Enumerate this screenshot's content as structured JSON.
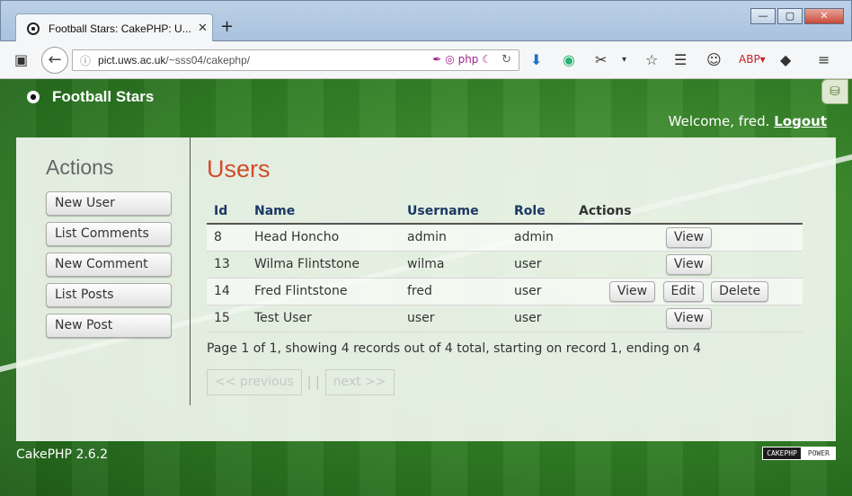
{
  "browser": {
    "tab_title": "Football Stars: CakePHP: U...",
    "tab_close": "✕",
    "new_tab": "+",
    "url_host": "pict.uws.ac.uk",
    "url_path": "/~sss04/cakephp/",
    "win_min": "—",
    "win_max": "▢",
    "win_close": "✕"
  },
  "header": {
    "title": "Football Stars",
    "welcome": "Welcome, fred.",
    "logout": "Logout"
  },
  "sidebar": {
    "heading": "Actions",
    "items": [
      {
        "label": "New User"
      },
      {
        "label": "List Comments"
      },
      {
        "label": "New Comment"
      },
      {
        "label": "List Posts"
      },
      {
        "label": "New Post"
      }
    ]
  },
  "main": {
    "heading": "Users",
    "columns": [
      "Id",
      "Name",
      "Username",
      "Role",
      "Actions"
    ],
    "rows": [
      {
        "id": "8",
        "name": "Head Honcho",
        "username": "admin",
        "role": "admin",
        "actions": [
          "View"
        ]
      },
      {
        "id": "13",
        "name": "Wilma Flintstone",
        "username": "wilma",
        "role": "user",
        "actions": [
          "View"
        ]
      },
      {
        "id": "14",
        "name": "Fred Flintstone",
        "username": "fred",
        "role": "user",
        "actions": [
          "View",
          "Edit",
          "Delete"
        ]
      },
      {
        "id": "15",
        "name": "Test User",
        "username": "user",
        "role": "user",
        "actions": [
          "View"
        ]
      }
    ],
    "page_info": "Page 1 of 1, showing 4 records out of 4 total, starting on record 1, ending on 4",
    "prev": "<< previous",
    "separator": "| |",
    "next": "next >>"
  },
  "footer": {
    "version": "CakePHP 2.6.2",
    "badge_left": "CAKEPHP",
    "badge_right": "POWER"
  },
  "colors": {
    "heading_red": "#d24b2e",
    "header_blue": "#1b3864",
    "grass_green": "#2f7a24"
  }
}
